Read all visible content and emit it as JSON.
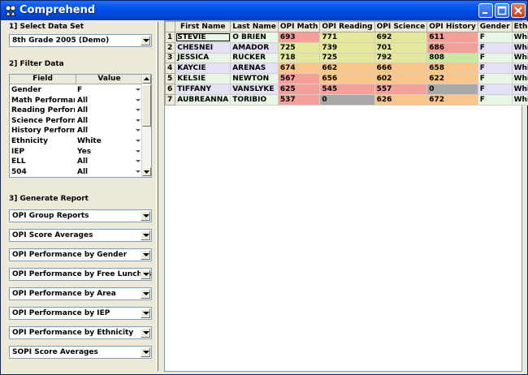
{
  "window": {
    "title": "Comprehend"
  },
  "colors": {
    "red": "#f4a09a",
    "orange": "#f8c58a",
    "yellow": "#e4e89a",
    "green": "#c8e8a0",
    "gray": "#a8a8a8",
    "row_purple": "#e4e0f6",
    "row_green": "#e8f6e8"
  },
  "left": {
    "section1": "1] Select Data Set",
    "dataset": "8th Grade 2005 (Demo)",
    "section2": "2] Filter Data",
    "filter_headers": {
      "field": "Field",
      "value": "Value"
    },
    "filters": [
      {
        "field": "Gender",
        "value": "F"
      },
      {
        "field": "Math Performance",
        "value": "All"
      },
      {
        "field": "Reading Performance",
        "value": "All"
      },
      {
        "field": "Science Performance",
        "value": "All"
      },
      {
        "field": "History Performance",
        "value": "All"
      },
      {
        "field": "Ethnicity",
        "value": "White"
      },
      {
        "field": "IEP",
        "value": "Yes"
      },
      {
        "field": "ELL",
        "value": "All"
      },
      {
        "field": "504",
        "value": "All"
      }
    ],
    "section3": "3] Generate Report",
    "reports": [
      "OPI Group Reports",
      "OPI Score Averages",
      "OPI Performance by Gender",
      "OPI Performance by Free Lunches",
      "OPI Performance by Area",
      "OPI Performance by IEP",
      "OPI Performance by Ethnicity",
      "SOPI Score Averages"
    ]
  },
  "grid": {
    "headers": [
      "First Name",
      "Last Name",
      "OPI Math",
      "OPI Reading",
      "OPI Science",
      "OPI History",
      "Gender",
      "Ethnicity"
    ],
    "rows": [
      {
        "num": "1",
        "first": "STEVIE",
        "last": "O BRIEN",
        "math": "693",
        "reading": "771",
        "science": "692",
        "history": "611",
        "gender": "F",
        "ethnicity": "White",
        "row": "green",
        "c": [
          "red",
          "yellow",
          "yellow",
          "red"
        ]
      },
      {
        "num": "2",
        "first": "CHESNEI",
        "last": "AMADOR",
        "math": "725",
        "reading": "739",
        "science": "701",
        "history": "686",
        "gender": "F",
        "ethnicity": "White",
        "row": "purple",
        "c": [
          "yellow",
          "yellow",
          "yellow",
          "red"
        ]
      },
      {
        "num": "3",
        "first": "JESSICA",
        "last": "RUCKER",
        "math": "718",
        "reading": "725",
        "science": "792",
        "history": "808",
        "gender": "F",
        "ethnicity": "White",
        "row": "green",
        "c": [
          "yellow",
          "yellow",
          "yellow",
          "green"
        ]
      },
      {
        "num": "4",
        "first": "KAYCIE",
        "last": "ARENAS",
        "math": "674",
        "reading": "662",
        "science": "666",
        "history": "658",
        "gender": "F",
        "ethnicity": "White",
        "row": "purple",
        "c": [
          "orange",
          "orange",
          "orange",
          "orange"
        ]
      },
      {
        "num": "5",
        "first": "KELSIE",
        "last": "NEWTON",
        "math": "567",
        "reading": "656",
        "science": "602",
        "history": "622",
        "gender": "F",
        "ethnicity": "White",
        "row": "green",
        "c": [
          "red",
          "orange",
          "orange",
          "orange"
        ]
      },
      {
        "num": "6",
        "first": "TIFFANY",
        "last": "VANSLYKE",
        "math": "625",
        "reading": "545",
        "science": "557",
        "history": "0",
        "gender": "F",
        "ethnicity": "White",
        "row": "purple",
        "c": [
          "red",
          "red",
          "red",
          "gray"
        ]
      },
      {
        "num": "7",
        "first": "AUBREANNA",
        "last": "TORIBIO",
        "math": "537",
        "reading": "0",
        "science": "626",
        "history": "672",
        "gender": "F",
        "ethnicity": "White",
        "row": "green",
        "c": [
          "red",
          "gray",
          "orange",
          "orange"
        ]
      }
    ]
  }
}
